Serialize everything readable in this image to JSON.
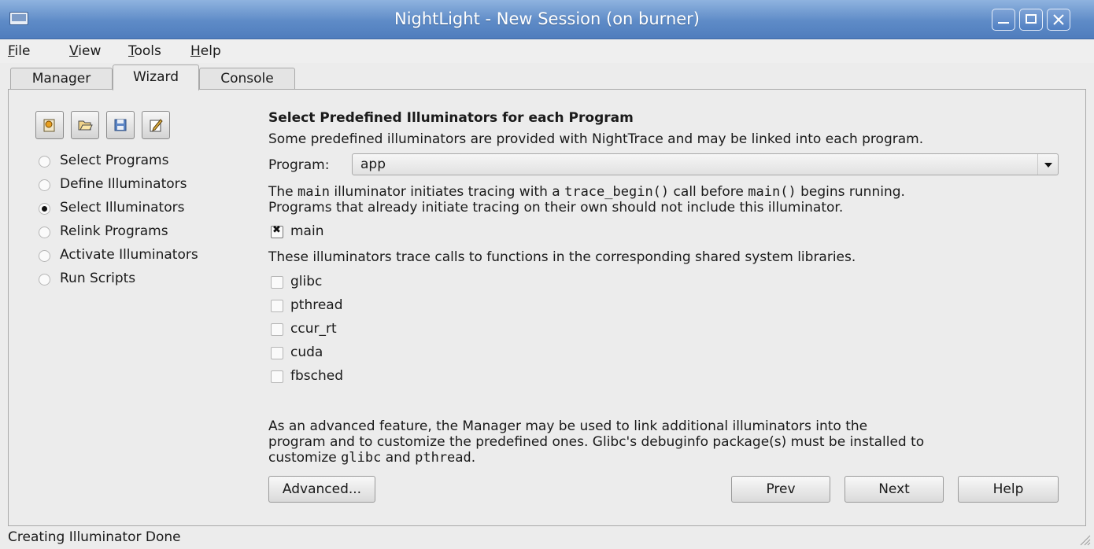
{
  "window": {
    "title": "NightLight - New Session (on burner)"
  },
  "menu": {
    "items": [
      {
        "mnemonic": "F",
        "rest": "ile"
      },
      {
        "mnemonic": "V",
        "rest": "iew"
      },
      {
        "mnemonic": "T",
        "rest": "ools"
      },
      {
        "mnemonic": "H",
        "rest": "elp"
      }
    ]
  },
  "tabs": [
    "Manager",
    "Wizard",
    "Console"
  ],
  "active_tab": "Wizard",
  "toolbar": {
    "icons": [
      "new-session-icon",
      "open-folder-icon",
      "save-icon",
      "edit-icon"
    ]
  },
  "steps": [
    {
      "label": "Select Programs",
      "selected": false
    },
    {
      "label": "Define Illuminators",
      "selected": false
    },
    {
      "label": "Select Illuminators",
      "selected": true
    },
    {
      "label": "Relink Programs",
      "selected": false
    },
    {
      "label": "Activate Illuminators",
      "selected": false
    },
    {
      "label": "Run Scripts",
      "selected": false
    }
  ],
  "main": {
    "heading": "Select Predefined Illuminators for each Program",
    "intro": "Some predefined illuminators are provided with NightTrace and may be linked into each program.",
    "program_label": "Program:",
    "program_value": "app",
    "main_desc": {
      "a": "The ",
      "code1": "main",
      "b": " illuminator initiates tracing with a ",
      "code2": "trace_begin()",
      "c": " call before ",
      "code3": "main()",
      "d": " begins running.",
      "line2": "Programs that already initiate tracing on their own should not include this illuminator."
    },
    "main_check": {
      "label": "main",
      "checked": true
    },
    "libs_desc": "These illuminators trace calls to functions in the corresponding shared system libraries.",
    "libs": [
      {
        "label": "glibc",
        "checked": false
      },
      {
        "label": "pthread",
        "checked": false
      },
      {
        "label": "ccur_rt",
        "checked": false
      },
      {
        "label": "cuda",
        "checked": false
      },
      {
        "label": "fbsched",
        "checked": false
      }
    ],
    "advanced_desc": {
      "line1": "As an advanced feature, the Manager may be used to link additional illuminators into the",
      "line2": "program and to customize the predefined ones. Glibc's debuginfo package(s) must be installed to",
      "line3a": "customize ",
      "code1": "glibc",
      "line3b": " and ",
      "code2": "pthread",
      "line3c": "."
    },
    "buttons": {
      "advanced": "Advanced...",
      "prev": "Prev",
      "next": "Next",
      "help": "Help"
    }
  },
  "status": "Creating Illuminator Done",
  "colors": {
    "titlebar": "#5e8bc7",
    "background": "#ececec"
  }
}
